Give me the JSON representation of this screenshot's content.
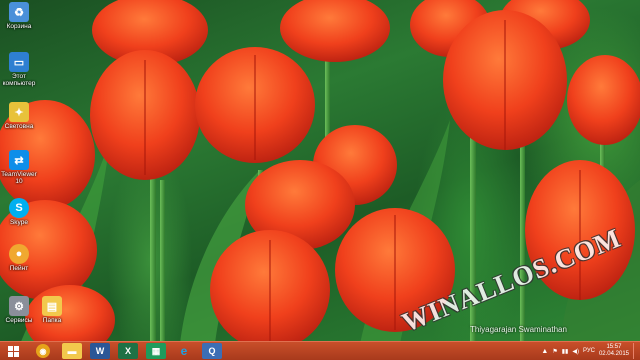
{
  "desktop": {
    "icons": [
      {
        "label": "Корзина",
        "icon": "recycle-bin-icon",
        "color": "#4a90d9"
      },
      {
        "label": "Этот\nкомпьютер",
        "icon": "computer-icon",
        "color": "#2e7fd1"
      },
      {
        "label": "Световна",
        "icon": "light-icon",
        "color": "#e8c23a"
      },
      {
        "label": "TeamViewer\n10",
        "icon": "teamviewer-icon",
        "color": "#0e8ee9"
      },
      {
        "label": "Skype",
        "icon": "skype-icon",
        "color": "#00aff0"
      },
      {
        "label": "Пейнт",
        "icon": "paint-icon",
        "color": "#f0a830"
      },
      {
        "label": "Сервисы",
        "icon": "tools-icon",
        "color": "#8a8f9a"
      },
      {
        "label": "Папка",
        "icon": "folder-icon",
        "color": "#f2c94c"
      }
    ]
  },
  "wallpaper": {
    "watermark": "WINALLOS.COM",
    "credit": "Thiyagarajan Swaminathan"
  },
  "taskbar": {
    "apps": [
      {
        "name": "chrome",
        "icon": "chrome-icon",
        "glyph": "◉",
        "color": "#e6a31a"
      },
      {
        "name": "explorer",
        "icon": "folder-icon",
        "glyph": "▬",
        "color": "#f2c94c"
      },
      {
        "name": "word",
        "icon": "word-icon",
        "glyph": "W",
        "color": "#2b5797"
      },
      {
        "name": "excel",
        "icon": "excel-icon",
        "glyph": "X",
        "color": "#1e7145"
      },
      {
        "name": "calculator",
        "icon": "calculator-icon",
        "glyph": "▦",
        "color": "#1e9b5c"
      },
      {
        "name": "internet-explorer",
        "icon": "ie-icon",
        "glyph": "e",
        "color": "#1fa0e0"
      },
      {
        "name": "app",
        "icon": "app-icon",
        "glyph": "Q",
        "color": "#3c6eb4"
      }
    ],
    "tray": {
      "lang": "РУС",
      "time": "15:57",
      "date": "02.04.2015"
    }
  }
}
